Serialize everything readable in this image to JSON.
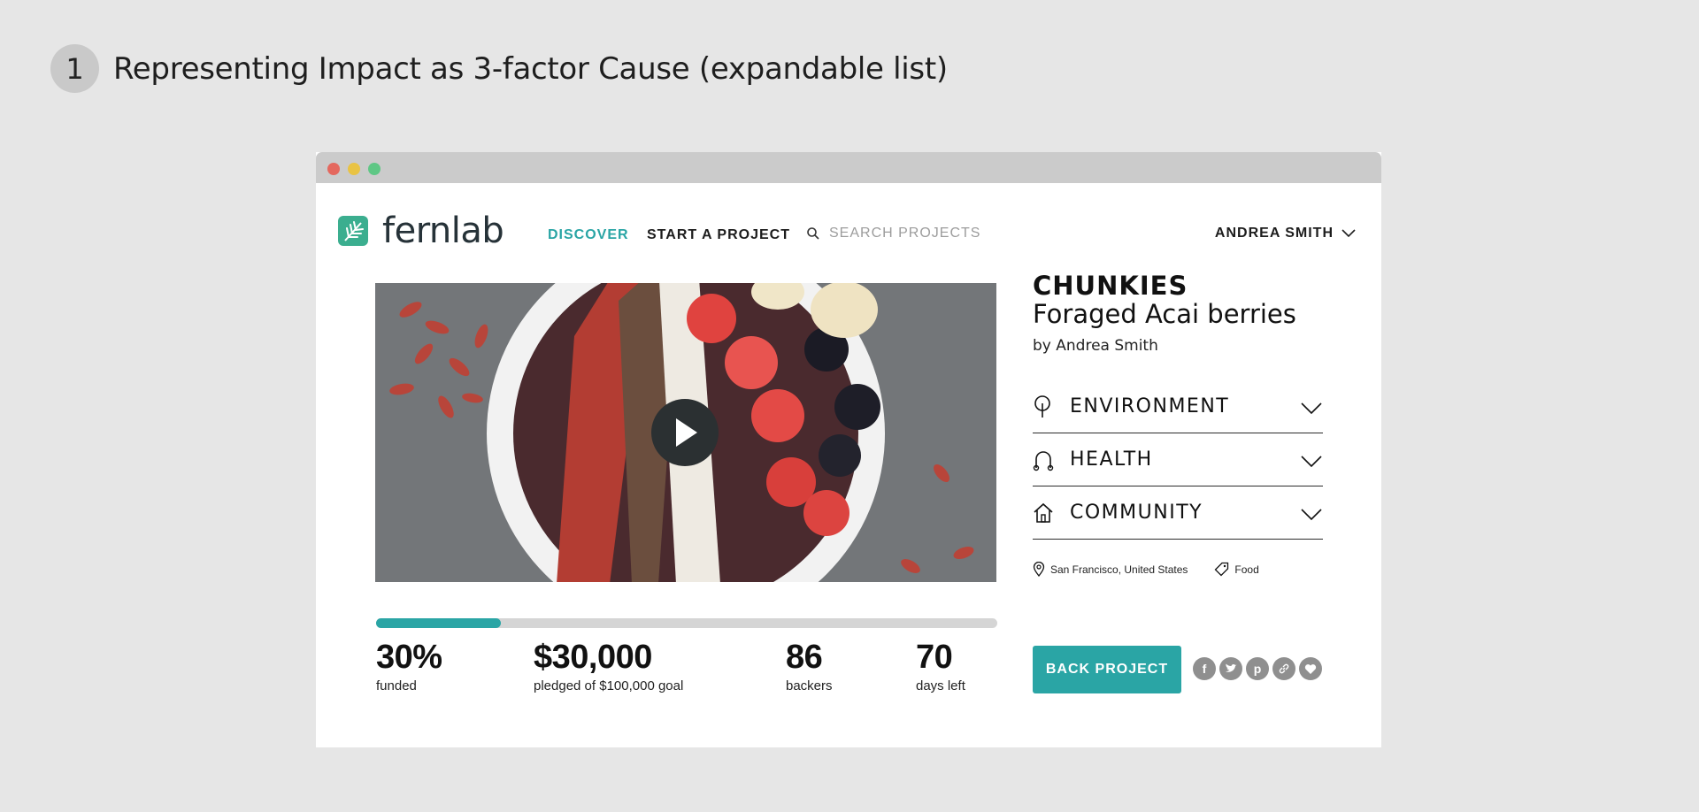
{
  "heading": {
    "step": "1",
    "title": "Representing Impact as 3-factor Cause (expandable list)"
  },
  "nav": {
    "logo_text": "fernlab",
    "discover": "DISCOVER",
    "start_project": "START A PROJECT",
    "search_placeholder": "SEARCH PROJECTS",
    "user_name": "ANDREA SMITH"
  },
  "colors": {
    "accent": "#2aa5a5",
    "logo": "#3bae8f"
  },
  "project": {
    "name": "CHUNKIES",
    "subtitle": "Foraged Acai berries",
    "author": "by Andrea Smith",
    "funded_fraction": 0.3,
    "stats": [
      {
        "value": "30%",
        "label": "funded"
      },
      {
        "value": "$30,000",
        "label": "pledged of $100,000 goal"
      },
      {
        "value": "86",
        "label": "backers"
      },
      {
        "value": "70",
        "label": "days left"
      }
    ],
    "factors": [
      {
        "label": "ENVIRONMENT",
        "icon": "tree-icon"
      },
      {
        "label": "HEALTH",
        "icon": "stethoscope-icon"
      },
      {
        "label": "COMMUNITY",
        "icon": "home-icon"
      }
    ],
    "location": "San Francisco, United States",
    "category": "Food",
    "back_button": "BACK PROJECT",
    "social": [
      "facebook-icon",
      "twitter-icon",
      "pinterest-icon",
      "link-icon",
      "heart-icon"
    ]
  }
}
